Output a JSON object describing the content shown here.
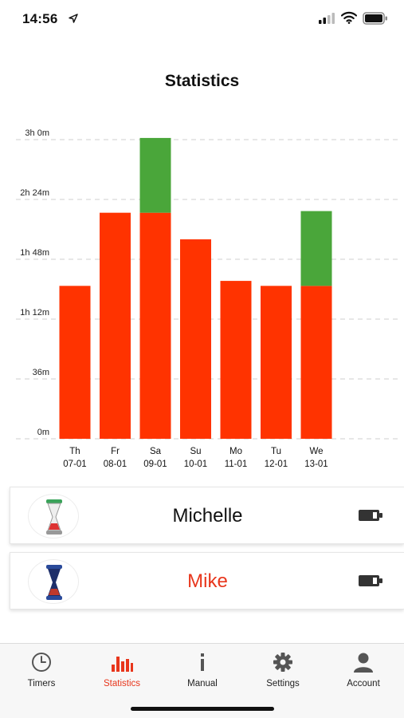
{
  "status_bar": {
    "time": "14:56",
    "icons": [
      "location-arrow-icon",
      "cellular-signal-icon",
      "wifi-icon",
      "battery-icon"
    ]
  },
  "page": {
    "title": "Statistics"
  },
  "colors": {
    "accent": "#e8361c",
    "bar_red": "#ff3300",
    "bar_green": "#4aa63a",
    "grid": "#cfcfcf"
  },
  "chart_data": {
    "type": "bar",
    "stacked": true,
    "categories": [
      "Th",
      "Fr",
      "Sa",
      "Su",
      "Mo",
      "Tu",
      "We"
    ],
    "category_dates": [
      "07-01",
      "08-01",
      "09-01",
      "10-01",
      "11-01",
      "12-01",
      "13-01"
    ],
    "unit": "minutes",
    "series": [
      {
        "color": "#ff3300",
        "values": [
          92,
          136,
          136,
          120,
          95,
          92,
          92
        ]
      },
      {
        "color": "#4aa63a",
        "values": [
          0,
          0,
          45,
          0,
          0,
          0,
          45
        ]
      }
    ],
    "ylim": [
      0,
      180
    ],
    "yticks": [
      0,
      36,
      72,
      108,
      144,
      180
    ],
    "ytick_labels": [
      "0m",
      "36m",
      "1h 12m",
      "1h 48m",
      "2h 24m",
      "3h 0m"
    ],
    "grid": true,
    "grid_style": "dashed",
    "legend": "none"
  },
  "users": [
    {
      "name": "Michelle",
      "avatar_icon": "hourglass-timer-icon",
      "status_icon": "battery-icon"
    },
    {
      "name": "Mike",
      "avatar_icon": "hourglass-timer-icon",
      "status_icon": "battery-icon"
    }
  ],
  "tabs": [
    {
      "label": "Timers",
      "icon": "clock-icon",
      "active": false
    },
    {
      "label": "Statistics",
      "icon": "bar-chart-icon",
      "active": true
    },
    {
      "label": "Manual",
      "icon": "info-icon",
      "active": false
    },
    {
      "label": "Settings",
      "icon": "gear-icon",
      "active": false
    },
    {
      "label": "Account",
      "icon": "person-icon",
      "active": false
    }
  ]
}
